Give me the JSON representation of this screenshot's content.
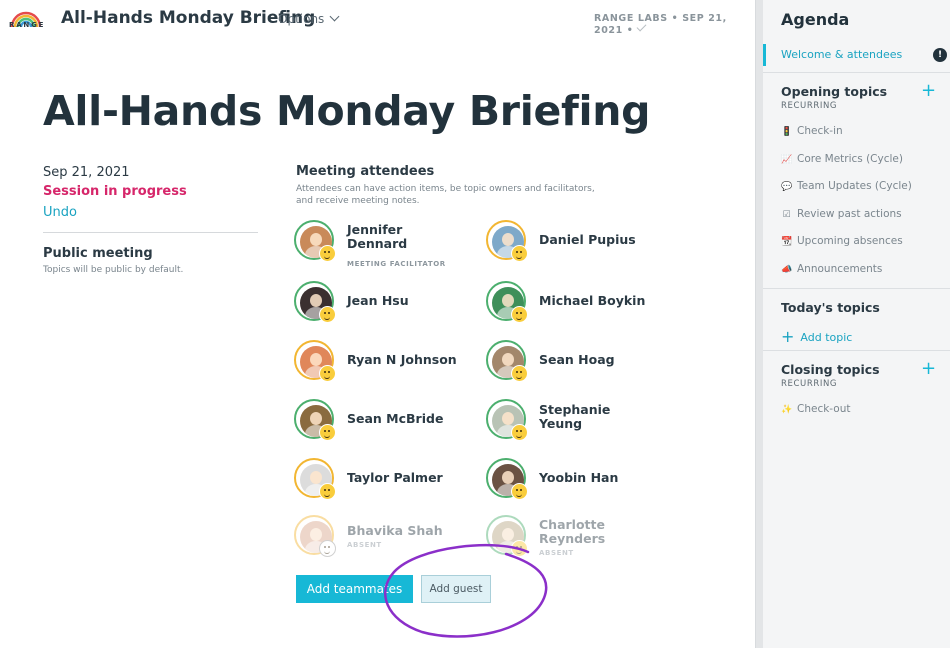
{
  "header": {
    "logo_text": "RANGE",
    "title": "All-Hands Monday Briefing",
    "options_label": "Options",
    "meta": "RANGE LABS • SEP 21, 2021 •"
  },
  "meeting": {
    "title": "All-Hands Monday Briefing",
    "date": "Sep 21, 2021",
    "status": "Session in progress",
    "undo": "Undo",
    "public_title": "Public meeting",
    "public_desc": "Topics will be public by default."
  },
  "attendees": {
    "title": "Meeting attendees",
    "description": "Attendees can have action items, be topic owners and facilitators, and receive meeting notes.",
    "people": [
      {
        "name": "Jennifer Dennard",
        "role": "MEETING FACILITATOR"
      },
      {
        "name": "Daniel Pupius",
        "role": ""
      },
      {
        "name": "Jean Hsu",
        "role": ""
      },
      {
        "name": "Michael Boykin",
        "role": ""
      },
      {
        "name": "Ryan N Johnson",
        "role": ""
      },
      {
        "name": "Sean Hoag",
        "role": ""
      },
      {
        "name": "Sean McBride",
        "role": ""
      },
      {
        "name": "Stephanie Yeung",
        "role": ""
      },
      {
        "name": "Taylor Palmer",
        "role": ""
      },
      {
        "name": "Yoobin Han",
        "role": ""
      },
      {
        "name": "Bhavika Shah",
        "role": "ABSENT"
      },
      {
        "name": "Charlotte Reynders",
        "role": "ABSENT"
      }
    ],
    "add_teammates": "Add teammates",
    "add_guest": "Add guest"
  },
  "agenda": {
    "title": "Agenda",
    "welcome": "Welcome & attendees",
    "alert": "!",
    "opening": "Opening topics",
    "recurring": "RECURRING",
    "opening_items": [
      {
        "icon": "traffic-light-icon",
        "glyph": "🚦",
        "label": "Check-in"
      },
      {
        "icon": "chart-icon",
        "glyph": "📈",
        "label": "Core Metrics (Cycle)"
      },
      {
        "icon": "speech-bubble-icon",
        "glyph": "💬",
        "label": "Team Updates (Cycle)"
      },
      {
        "icon": "checkbox-icon",
        "glyph": "☑",
        "label": "Review past actions"
      },
      {
        "icon": "calendar-icon",
        "glyph": "📆",
        "label": "Upcoming absences"
      },
      {
        "icon": "megaphone-icon",
        "glyph": "📣",
        "label": "Announcements"
      }
    ],
    "today": "Today's topics",
    "add_topic": "Add topic",
    "closing": "Closing topics",
    "closing_recurring": "RECURRING",
    "closing_items": [
      {
        "icon": "sparkles-icon",
        "glyph": "✨",
        "label": "Check-out"
      }
    ]
  },
  "colors": {
    "accent": "#17b8d6",
    "session_status": "#d6266a",
    "annotation_circle": "#8b2fc9"
  }
}
